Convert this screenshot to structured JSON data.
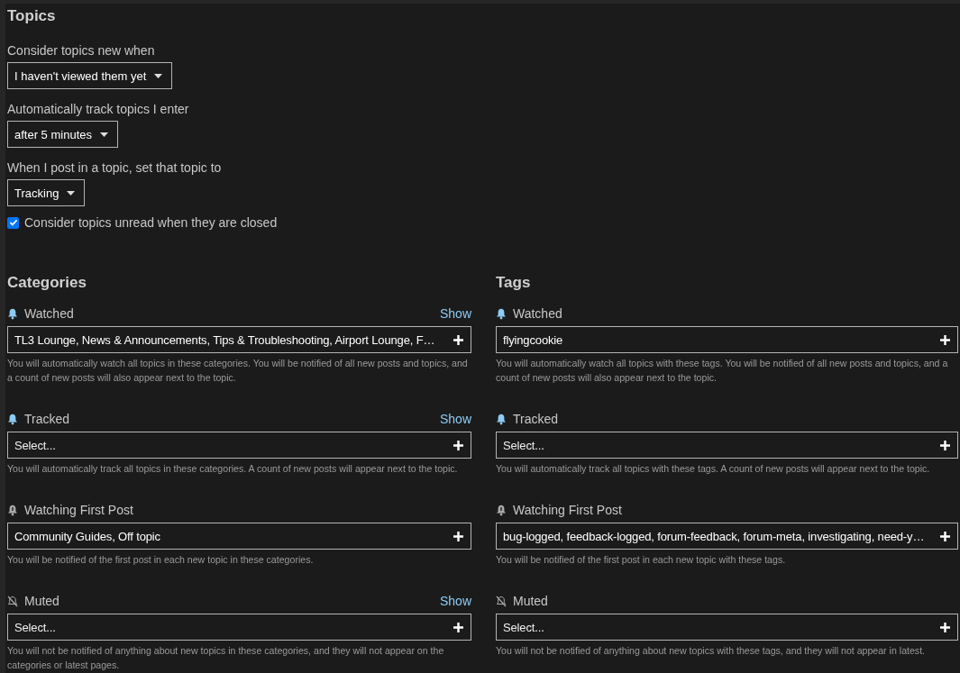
{
  "topics": {
    "title": "Topics",
    "dropdowns": [
      {
        "label": "Consider topics new when",
        "value": "I haven't viewed them yet"
      },
      {
        "label": "Automatically track topics I enter",
        "value": "after 5 minutes"
      },
      {
        "label": "When I post in a topic, set that topic to",
        "value": "Tracking"
      }
    ],
    "checkbox": {
      "label": "Consider topics unread when they are closed",
      "checked": true
    }
  },
  "columns": [
    {
      "title": "Categories",
      "groups": [
        {
          "kind": "watched",
          "label": "Watched",
          "link": "Show",
          "value": "TL3 Lounge, News & Announcements, Tips & Troubleshooting, Airport Lounge, F…",
          "description": "You will automatically watch all topics in these categories. You will be notified of all new posts and topics, and a count of new posts will also appear next to the topic."
        },
        {
          "kind": "tracked",
          "label": "Tracked",
          "link": "Show",
          "placeholder": "Select...",
          "description": "You will automatically track all topics in these categories. A count of new posts will appear next to the topic."
        },
        {
          "kind": "first",
          "label": "Watching First Post",
          "value": "Community Guides, Off topic",
          "description": "You will be notified of the first post in each new topic in these categories."
        },
        {
          "kind": "muted",
          "label": "Muted",
          "link": "Show",
          "placeholder": "Select...",
          "description": "You will not be notified of anything about new topics in these categories, and they will not appear on the categories or latest pages."
        }
      ]
    },
    {
      "title": "Tags",
      "groups": [
        {
          "kind": "watched",
          "label": "Watched",
          "value": "flyingcookie",
          "description": "You will automatically watch all topics with these tags. You will be notified of all new posts and topics, and a count of new posts will also appear next to the topic."
        },
        {
          "kind": "tracked",
          "label": "Tracked",
          "placeholder": "Select...",
          "description": "You will automatically track all topics with these tags. A count of new posts will appear next to the topic."
        },
        {
          "kind": "first",
          "label": "Watching First Post",
          "value": "bug-logged, feedback-logged, forum-feedback, forum-meta, investigating, need-y…",
          "description": "You will be notified of the first post in each new topic with these tags."
        },
        {
          "kind": "muted",
          "label": "Muted",
          "placeholder": "Select...",
          "description": "You will not be notified of anything about new topics with these tags, and they will not appear in latest."
        }
      ]
    }
  ]
}
